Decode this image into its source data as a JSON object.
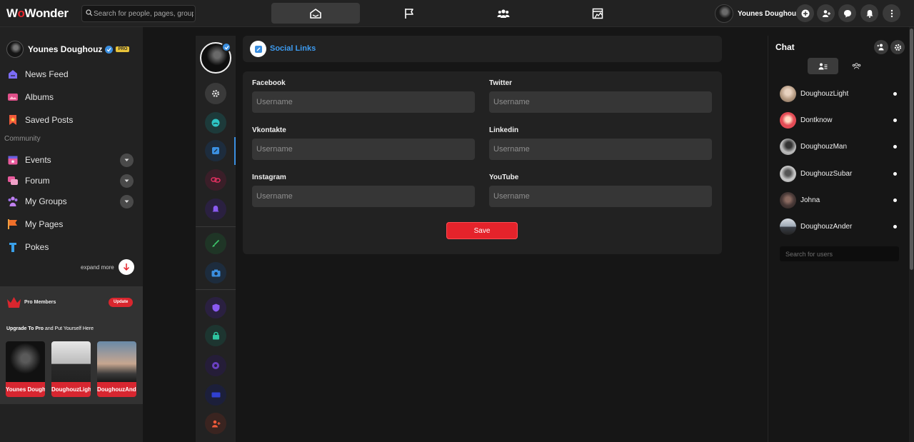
{
  "header": {
    "logo": {
      "w": "W",
      "o": "o",
      "rest": "Wonder"
    },
    "search_placeholder": "Search for people, pages, groups and #hashtags",
    "nav": [
      {
        "name": "home-icon",
        "active": true
      },
      {
        "name": "flag-icon",
        "active": false
      },
      {
        "name": "groups-icon",
        "active": false
      },
      {
        "name": "store-icon",
        "active": false
      }
    ],
    "user_name": "Younes Doughouz"
  },
  "sidebar": {
    "user_name": "Younes Doughouz",
    "pro_badge": "PRO",
    "items": [
      {
        "label": "News Feed",
        "icon": "news-feed-icon",
        "color": "#7b6cf6"
      },
      {
        "label": "Albums",
        "icon": "albums-icon",
        "color": "#e0508a"
      },
      {
        "label": "Saved Posts",
        "icon": "saved-posts-icon",
        "color": "#f05a3a"
      }
    ],
    "community_label": "Community",
    "community_items": [
      {
        "label": "Events",
        "icon": "events-icon",
        "color": "#e85a9c"
      },
      {
        "label": "Forum",
        "icon": "forum-icon",
        "color": "#e85a9c"
      },
      {
        "label": "My Groups",
        "icon": "my-groups-icon",
        "color": "#a070e8"
      },
      {
        "label": "My Pages",
        "icon": "my-pages-icon",
        "color": "#f0702a"
      },
      {
        "label": "Pokes",
        "icon": "pokes-icon",
        "color": "#3aa0e8"
      }
    ],
    "expand_more": "expand more",
    "pro_box": {
      "title": "Pro Members",
      "update_label": "Update",
      "upgrade_strong": "Upgrade To Pro",
      "upgrade_rest": " and Put Yourself Here",
      "members": [
        "Younes Doughouz",
        "DoughouzLight",
        "DoughouzAnder"
      ]
    }
  },
  "settings_icons": [
    {
      "name": "general-settings-icon",
      "color": "#e0e0e0",
      "bg": "#3a3a3a"
    },
    {
      "name": "profile-icon",
      "color": "#2ec4c4",
      "bg": "#1d3a3a"
    },
    {
      "name": "social-links-icon",
      "color": "#3b8fe0",
      "bg": "#1d2c3d"
    },
    {
      "name": "privacy-link-icon",
      "color": "#e03060",
      "bg": "#3a1e28"
    },
    {
      "name": "notifications-icon",
      "color": "#8a5af0",
      "bg": "#2a2040"
    },
    {
      "name": "design-icon",
      "color": "#3ec46a",
      "bg": "#1f3526"
    },
    {
      "name": "avatar-cover-icon",
      "color": "#3b8fe0",
      "bg": "#1d2c3d"
    },
    {
      "name": "security-icon",
      "color": "#8a5af0",
      "bg": "#2a2040"
    },
    {
      "name": "password-icon",
      "color": "#2ec4a0",
      "bg": "#1d3530"
    },
    {
      "name": "sessions-icon",
      "color": "#6a40c0",
      "bg": "#251d38"
    },
    {
      "name": "monetization-icon",
      "color": "#3040d0",
      "bg": "#1c1f3a"
    },
    {
      "name": "invite-icon",
      "color": "#f05a3a",
      "bg": "#3a2420"
    }
  ],
  "page": {
    "title": "Social Links",
    "fields": [
      {
        "label": "Facebook",
        "placeholder": "Username",
        "value": ""
      },
      {
        "label": "Twitter",
        "placeholder": "Username",
        "value": ""
      },
      {
        "label": "Vkontakte",
        "placeholder": "Username",
        "value": ""
      },
      {
        "label": "Linkedin",
        "placeholder": "Username",
        "value": ""
      },
      {
        "label": "Instagram",
        "placeholder": "Username",
        "value": ""
      },
      {
        "label": "YouTube",
        "placeholder": "Username",
        "value": ""
      }
    ],
    "save_label": "Save"
  },
  "chat": {
    "title": "Chat",
    "users": [
      {
        "name": "DoughouzLight",
        "avatar": "#b59a82"
      },
      {
        "name": "Dontknow",
        "avatar": "#e34b55"
      },
      {
        "name": "DoughouzMan",
        "avatar": "#8a8a8a"
      },
      {
        "name": "DoughouzSubar",
        "avatar": "#9a9a9a"
      },
      {
        "name": "Johna",
        "avatar": "#4a3a38"
      },
      {
        "name": "DoughouzAnder",
        "avatar": "#6f7a88"
      }
    ],
    "search_placeholder": "Search for users"
  },
  "colors": {
    "accent": "#3b8fe0",
    "danger": "#e5232b",
    "surface": "#222222",
    "background": "#161616"
  }
}
